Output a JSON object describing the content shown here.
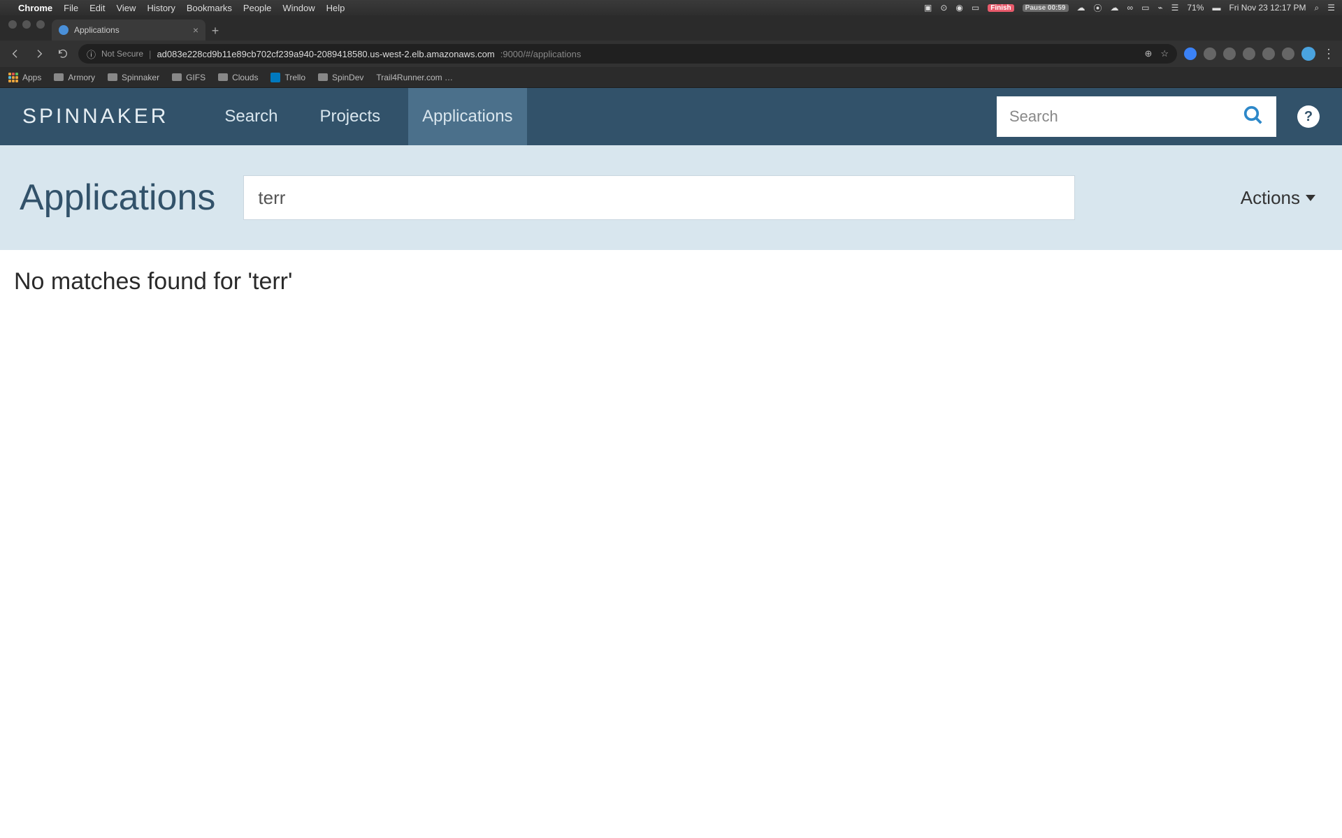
{
  "mac": {
    "app": "Chrome",
    "menus": [
      "File",
      "Edit",
      "View",
      "History",
      "Bookmarks",
      "People",
      "Window",
      "Help"
    ],
    "finish_label": "Finish",
    "pause_label": "Pause 00:59",
    "battery_pct": "71%",
    "datetime": "Fri Nov 23  12:17 PM"
  },
  "chrome": {
    "tab_title": "Applications",
    "not_secure": "Not Secure",
    "url_host": "ad083e228cd9b11e89cb702cf239a940-2089418580.us-west-2.elb.amazonaws.com",
    "url_port_path": ":9000/#/applications",
    "bookmarks": [
      {
        "label": "Apps",
        "type": "apps"
      },
      {
        "label": "Armory",
        "type": "folder"
      },
      {
        "label": "Spinnaker",
        "type": "folder"
      },
      {
        "label": "GIFS",
        "type": "folder"
      },
      {
        "label": "Clouds",
        "type": "folder"
      },
      {
        "label": "Trello",
        "type": "trello"
      },
      {
        "label": "SpinDev",
        "type": "folder"
      },
      {
        "label": "Trail4Runner.com …",
        "type": "page"
      }
    ]
  },
  "spinnaker": {
    "brand": "SPINNAKER",
    "nav": [
      {
        "label": "Search",
        "active": false
      },
      {
        "label": "Projects",
        "active": false
      },
      {
        "label": "Applications",
        "active": true
      }
    ],
    "global_search_placeholder": "Search"
  },
  "page": {
    "title": "Applications",
    "filter_value": "terr",
    "actions_label": "Actions",
    "no_matches_text": "No matches found for 'terr'"
  }
}
